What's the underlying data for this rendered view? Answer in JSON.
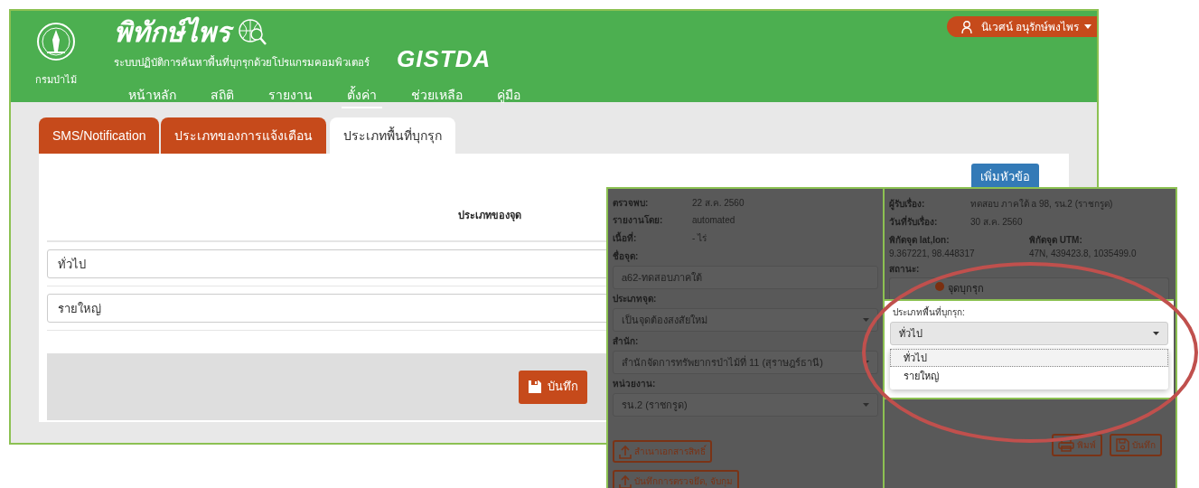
{
  "header": {
    "agency_label": "กรมป่าไม้",
    "app_title": "พิทักษ์ไพร",
    "app_subtitle": "ระบบปฏิบัติการค้นหาพื้นที่บุกรุกด้วยโปรแกรมคอมพิวเตอร์",
    "partner_logo": "GISTDA",
    "user_name": "นิเวศน์ อนุรักษ์พงไพร"
  },
  "nav": [
    {
      "label": "หน้าหลัก",
      "selected": false
    },
    {
      "label": "สถิติ",
      "selected": false
    },
    {
      "label": "รายงาน",
      "selected": false
    },
    {
      "label": "ตั้งค่า",
      "selected": true
    },
    {
      "label": "ช่วยเหลือ",
      "selected": false
    },
    {
      "label": "คู่มือ",
      "selected": false
    }
  ],
  "tabs": [
    {
      "label": "SMS/Notification",
      "selected": false
    },
    {
      "label": "ประเภทของการแจ้งเตือน",
      "selected": false
    },
    {
      "label": "ประเภทพื้นที่บุกรุก",
      "selected": true
    }
  ],
  "add_button": "เพิ่มหัวข้อ",
  "table": {
    "column_header": "ประเภทของจุด",
    "rows": [
      {
        "value": "ทั่วไป"
      },
      {
        "value": "รายใหญ่"
      }
    ]
  },
  "save_button": "บันทึก",
  "detail_panel": {
    "left_info": [
      {
        "label": "ตรวจพบ:",
        "value": "22 ส.ค. 2560"
      },
      {
        "label": "รายงานโดย:",
        "value": "automated"
      },
      {
        "label": "เนื้อที่:",
        "value": "- ไร่"
      }
    ],
    "left_fields": [
      {
        "kind": "input",
        "label": "ชื่อจุด:",
        "value": "a62-ทดสอบภาคใต้"
      },
      {
        "kind": "select",
        "label": "ประเภทจุด:",
        "value": "เป็นจุดต้องสงสัยใหม่"
      },
      {
        "kind": "select",
        "label": "สำนัก:",
        "value": "สำนักจัดการทรัพยากรป่าไม้ที่ 11 (สุราษฎร์ธานี)"
      },
      {
        "kind": "select",
        "label": "หน่วยงาน:",
        "value": "รน.2 (ราชกรูด)"
      }
    ],
    "upload_buttons": [
      "สำเนาเอกสารสิทธิ์",
      "บันทึกการตรวจยึด, จับกุม"
    ],
    "right_info": [
      {
        "label": "ผู้รับเรื่อง:",
        "value": "ทดสอบ ภาคใต้ a 98, รน.2 (ราชกรูด)"
      },
      {
        "label": "วันที่รับเรื่อง:",
        "value": "30 ส.ค. 2560"
      }
    ],
    "coords": [
      {
        "label": "พิกัดจุด lat,lon:",
        "value": "9.367221, 98.448317"
      },
      {
        "label": "พิกัดจุด UTM:",
        "value": "47N, 439423.8, 1035499.0"
      }
    ],
    "status": {
      "label": "สถานะ:",
      "value": "จุดบุกรุก"
    },
    "encroachment_type": {
      "label": "ประเภทพื้นที่บุกรุก:",
      "value": "ทั่วไป",
      "options": [
        {
          "label": "ทั่วไป",
          "selected": true
        },
        {
          "label": "รายใหญ่",
          "selected": false
        }
      ]
    },
    "action_buttons": [
      {
        "kind": "print",
        "label": "พิมพ์"
      },
      {
        "kind": "save",
        "label": "บันทึก"
      }
    ]
  }
}
